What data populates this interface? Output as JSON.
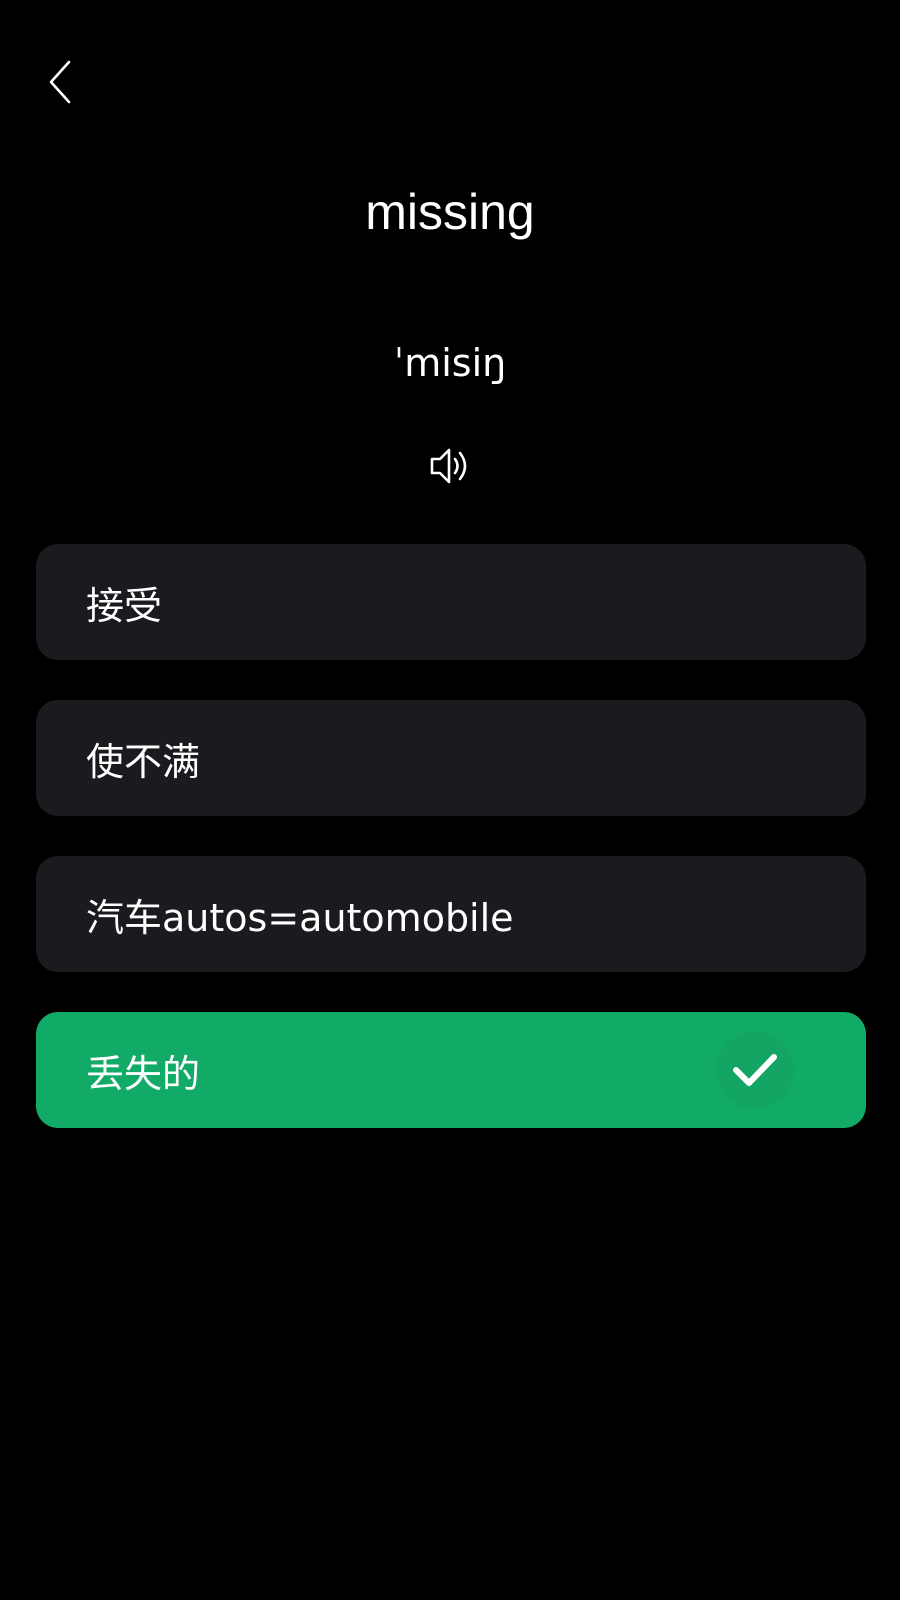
{
  "header": {
    "back_icon": "chevron-left-icon"
  },
  "card": {
    "word": "missing",
    "phonetic": "ˈmisiŋ",
    "speaker_icon": "speaker-icon"
  },
  "options": [
    {
      "label": "接受",
      "state": "default"
    },
    {
      "label": "使不满",
      "state": "default"
    },
    {
      "label": "汽车autos=automobile",
      "state": "default"
    },
    {
      "label": "丢失的",
      "state": "correct",
      "status_icon": "checkmark-icon"
    }
  ],
  "colors": {
    "background": "#000000",
    "option_bg": "#1a1b1f",
    "correct_bg": "#12aa67",
    "text": "#ffffff"
  }
}
